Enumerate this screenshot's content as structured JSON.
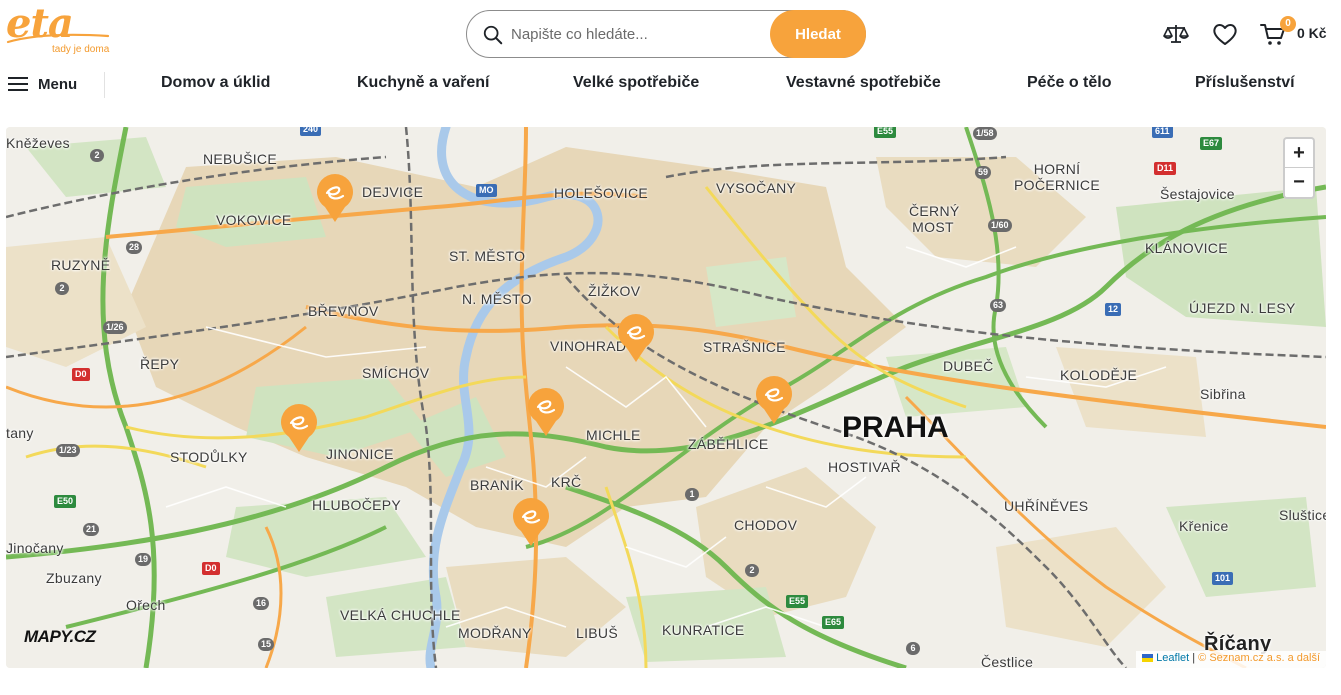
{
  "header": {
    "logo_text": "eta",
    "logo_tagline": "tady je doma",
    "search": {
      "placeholder": "Napište co hledáte...",
      "value": "",
      "button_label": "Hledat"
    },
    "compare_icon": "scales-icon",
    "wishlist_icon": "heart-icon",
    "cart": {
      "icon": "cart-icon",
      "count": "0",
      "total": "0 Kč"
    },
    "accent_color": "#f7a33c"
  },
  "nav": {
    "menu_label": "Menu",
    "items": [
      "Domov a úklid",
      "Kuchyně a vaření",
      "Velké spotřebiče",
      "Vestavné spotřebiče",
      "Péče o tělo",
      "Příslušenství"
    ]
  },
  "map": {
    "city": "PRAHA",
    "districts": [
      "Kněževes",
      "NEBUŠICE",
      "VOKOVICE",
      "RUZYNĚ",
      "BŘEVNOV",
      "ŘEPY",
      "SMÍCHOV",
      "STODŮLKY",
      "JINONICE",
      "HLUBOČEPY",
      "Zbuzany",
      "Ořech",
      "VELKÁ CHUCHLE",
      "MODŘANY",
      "LIBUŠ",
      "KUNRATICE",
      "CHODOV",
      "BRANÍK",
      "KRČ",
      "MICHLE",
      "ZÁBĚHLICE",
      "HOSTIVAŘ",
      "STRAŠNICE",
      "VINOHRADY",
      "ŽIŽKOV",
      "N. MĚSTO",
      "ST. MĚSTO",
      "HOLEŠOVICE",
      "VYSOČANY",
      "ČERNÝ MOST",
      "HORNÍ POČERNICE",
      "Šestajovice",
      "KLÁNOVICE",
      "ÚJEZD N. LESY",
      "DUBEČ",
      "KOLODĚJE",
      "Sibřina",
      "UHŘÍNĚVES",
      "Křenice",
      "Sluštice",
      "Říčany",
      "Čestlice",
      "Jinočany",
      "DEJVICE",
      "tany"
    ],
    "road_shields": [
      "240",
      "2",
      "28",
      "2",
      "1/26",
      "D0",
      "1/23",
      "E50",
      "21",
      "19",
      "D0",
      "16",
      "15",
      "MO",
      "E55",
      "1/58",
      "611",
      "E67",
      "D11",
      "59",
      "1/60",
      "63",
      "12",
      "1",
      "2",
      "E55",
      "E65",
      "6",
      "101"
    ],
    "store_count": 6,
    "zoom_in_label": "+",
    "zoom_out_label": "−",
    "provider_logo": "MAPY.CZ",
    "attribution": {
      "leaflet": "Leaflet",
      "separator": "|",
      "source": "© Seznam.cz a.s. a další"
    }
  }
}
